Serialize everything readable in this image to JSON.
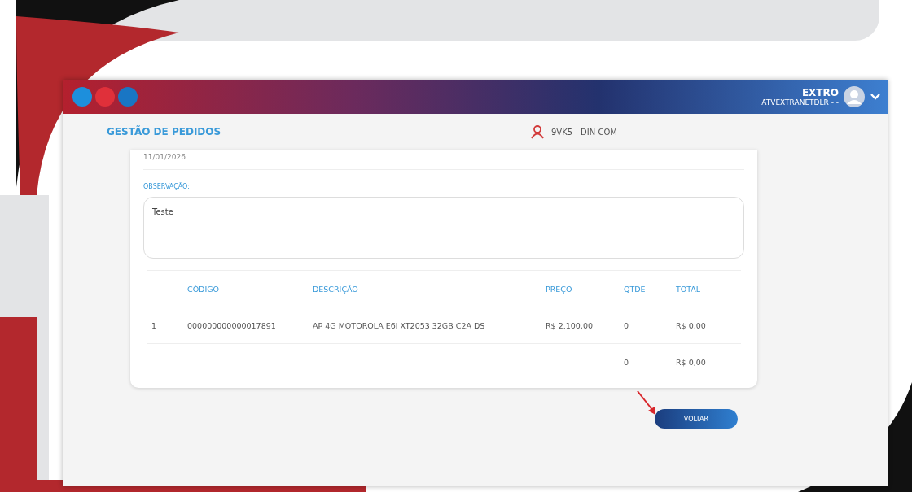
{
  "header": {
    "company": "EXTRO",
    "user": "ATVEXTRANETDLR - -"
  },
  "page": {
    "title": "GESTÃO DE PEDIDOS",
    "store": "9VK5 - DIN COM"
  },
  "order": {
    "date": "11/01/2026",
    "observation_label": "OBSERVAÇÃO:",
    "observation": "Teste"
  },
  "table": {
    "header": {
      "code": "CÓDIGO",
      "description": "DESCRIÇÃO",
      "price": "PREÇO",
      "quantity": "QTDE",
      "total": "TOTAL"
    },
    "rows": [
      {
        "item": "1",
        "code": "000000000000017891",
        "description": "AP 4G MOTOROLA E6i XT2053 32GB C2A DS",
        "price": "R$ 2.100,00",
        "quantity": "0",
        "total": "R$ 0,00"
      }
    ],
    "totals": {
      "quantity": "0",
      "total": "R$ 0,00"
    }
  },
  "buttons": [
    "VOLTAR"
  ]
}
